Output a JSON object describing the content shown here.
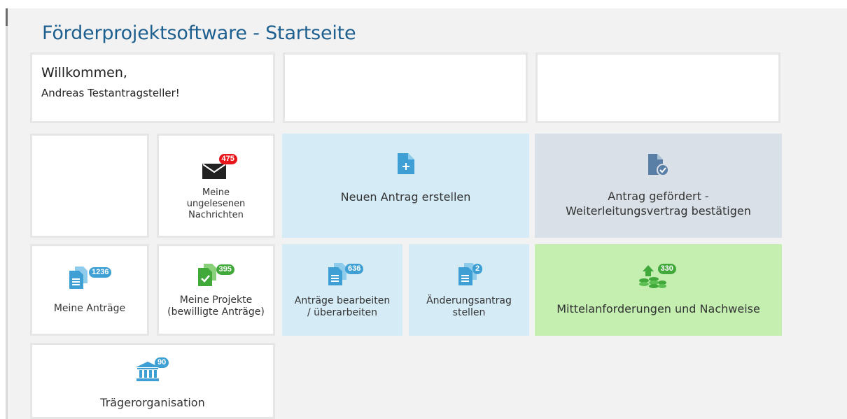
{
  "sidebar": {
    "collapse_label": "«"
  },
  "page": {
    "title": "Förderprojektsoftware - Startseite"
  },
  "welcome": {
    "greeting": "Willkommen,",
    "user": "Andreas Testantragsteller!"
  },
  "tiles": {
    "messages": {
      "label_lines": [
        "Meine",
        "ungelesenen",
        "Nachrichten"
      ],
      "badge": "475",
      "icon": "envelope-icon"
    },
    "new_application": {
      "label": "Neuen Antrag erstellen",
      "icon": "document-plus-icon"
    },
    "funded_application": {
      "label_lines": [
        "Antrag gefördert -",
        "Weiterleitungsvertrag bestätigen"
      ],
      "icon": "document-check-icon"
    },
    "my_applications": {
      "label": "Meine Anträge",
      "badge": "1236",
      "icon": "documents-icon"
    },
    "my_projects": {
      "label_lines": [
        "Meine Projekte",
        "(bewilligte Anträge)"
      ],
      "badge": "395",
      "icon": "documents-check-icon"
    },
    "edit_applications": {
      "label_lines": [
        "Anträge bearbeiten",
        "/ überarbeiten"
      ],
      "badge": "636",
      "icon": "documents-icon"
    },
    "change_request": {
      "label_lines": [
        "Änderungsantrag",
        "stellen"
      ],
      "badge": "2",
      "icon": "documents-icon"
    },
    "funds": {
      "label": "Mittelanforderungen und Nachweise",
      "badge": "330",
      "icon": "coins-arrow-icon"
    },
    "organisation": {
      "label": "Trägerorganisation",
      "badge": "90",
      "icon": "institution-icon"
    }
  },
  "colors": {
    "title": "#1d5f8f",
    "tile_blue": "#d5ecf7",
    "tile_grey": "#d9e0e8",
    "tile_green": "#c4efb1",
    "badge_red": "#e8161a",
    "badge_blue": "#3d9fd3",
    "badge_green": "#41a83a",
    "icon_blue": "#3d9fd3"
  }
}
